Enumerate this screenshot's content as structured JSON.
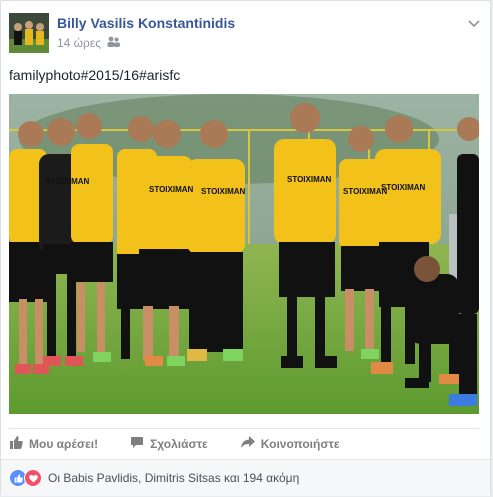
{
  "post": {
    "author": "Billy Vasilis Konstantinidis",
    "time": "14 ώρες",
    "audience_icon": "friends-icon",
    "text": "familyphoto#2015/16#arisfc"
  },
  "actions": {
    "like": "Μου αρέσει!",
    "comment": "Σχολιάστε",
    "share": "Κοινοποιήστε"
  },
  "reactions": {
    "summary": "Οι Babis Pavlidis, Dimitris Sitsas και 194 ακόμη",
    "types": [
      "like",
      "love"
    ]
  },
  "photo": {
    "shirt_print": "STOIXIMAN"
  },
  "colors": {
    "link": "#365899",
    "jersey": "#f2c21a",
    "grass": "#6aa33a",
    "like": "#5890ff",
    "love": "#f25268"
  }
}
